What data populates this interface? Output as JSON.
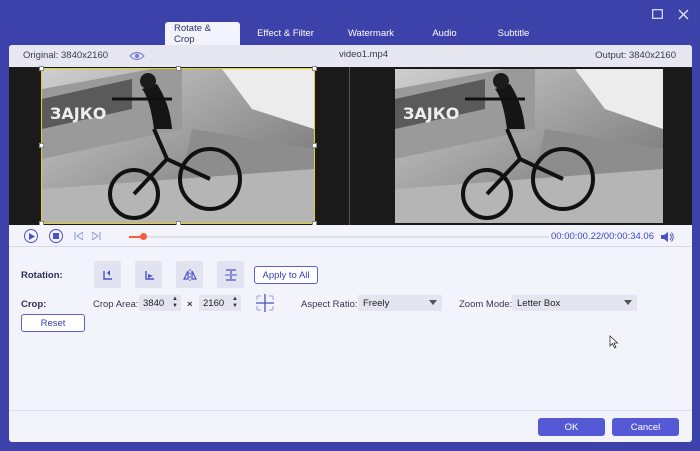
{
  "tabs": [
    {
      "label": "Rotate & Crop",
      "active": true
    },
    {
      "label": "Effect & Filter",
      "active": false
    },
    {
      "label": "Watermark",
      "active": false
    },
    {
      "label": "Audio",
      "active": false
    },
    {
      "label": "Subtitle",
      "active": false
    }
  ],
  "info": {
    "original": "Original: 3840x2160",
    "filename": "video1.mp4",
    "output": "Output: 3840x2160"
  },
  "player": {
    "time": "00:00:00.22/00:00:34.06",
    "progress": 0.033
  },
  "rotation": {
    "label": "Rotation:",
    "apply_all": "Apply to All"
  },
  "crop": {
    "label": "Crop:",
    "area_label": "Crop Area:",
    "width": "3840",
    "times": "×",
    "height": "2160",
    "aspect_label": "Aspect Ratio:",
    "aspect_value": "Freely",
    "zoom_label": "Zoom Mode:",
    "zoom_value": "Letter Box",
    "reset": "Reset"
  },
  "footer": {
    "ok": "OK",
    "cancel": "Cancel"
  },
  "colors": {
    "window_bg": "#3d41aa",
    "accent": "#5559d6",
    "crop_frame": "#e3d021",
    "progress": "#ff5a3c",
    "time_text": "#3a48c9"
  }
}
